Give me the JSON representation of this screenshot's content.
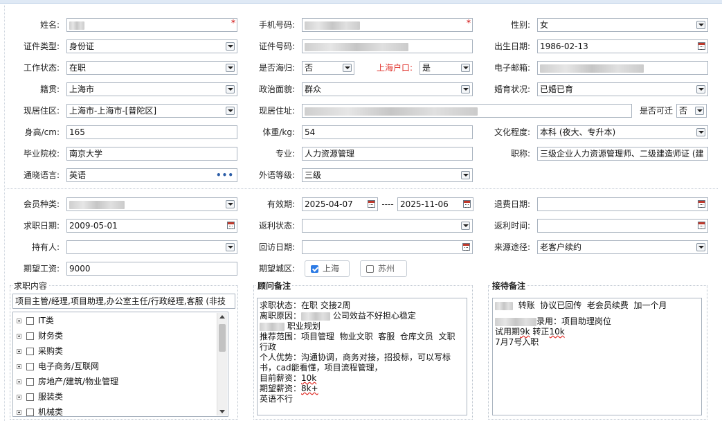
{
  "row1": {
    "name_label": "姓名:",
    "mobile_label": "手机号码:",
    "gender_label": "性别:",
    "gender_value": "女"
  },
  "row2": {
    "idtype_label": "证件类型:",
    "idtype_value": "身份证",
    "idno_label": "证件号码:",
    "birth_label": "出生日期:",
    "birth_value": "1986-02-13"
  },
  "row3": {
    "workstatus_label": "工作状态:",
    "workstatus_value": "在职",
    "returnee_label": "是否海归:",
    "returnee_value": "否",
    "hukou_label": "上海户口:",
    "hukou_value": "是",
    "email_label": "电子邮箱:"
  },
  "row4": {
    "native_label": "籍贯:",
    "native_value": "上海市",
    "political_label": "政治面貌:",
    "political_value": "群众",
    "marital_label": "婚育状况:",
    "marital_value": "已婚已育"
  },
  "row5": {
    "residence_area_label": "现居住区:",
    "residence_area_value": "上海市-上海市-[普陀区]",
    "address_label": "现居住址:",
    "relocate_label": "是否可迁",
    "relocate_value": "否"
  },
  "row6": {
    "height_label": "身高/cm:",
    "height_value": "165",
    "weight_label": "体重/kg:",
    "weight_value": "54",
    "education_label": "文化程度:",
    "education_value": "本科 (夜大、专升本)"
  },
  "row7": {
    "school_label": "毕业院校:",
    "school_value": "南京大学",
    "major_label": "专业:",
    "major_value": "人力资源管理",
    "title_label": "职称:",
    "title_value": "三级企业人力资源管理师、二级建造师证 (建"
  },
  "row8": {
    "language_label": "通晓语言:",
    "language_value": "英语",
    "language_more": "•••",
    "foreign_label": "外语等级:",
    "foreign_value": "三级"
  },
  "row9": {
    "member_label": "会员种类:",
    "valid_label": "有效期:",
    "valid_from": "2025-04-07",
    "valid_sep": "----",
    "valid_to": "2025-11-06",
    "refund_label": "退费日期:"
  },
  "row10": {
    "jobdate_label": "求职日期:",
    "jobdate_value": "2009-05-01",
    "rebate_status_label": "返利状态:",
    "rebate_time_label": "返利时间:"
  },
  "row11": {
    "holder_label": "持有人:",
    "visit_label": "回访日期:",
    "source_label": "来源途径:",
    "source_value": "老客户续约"
  },
  "row12": {
    "salary_label": "期望工资:",
    "salary_value": "9000",
    "city_label": "期望城区:",
    "city_options": [
      {
        "label": "上海",
        "checked": true
      },
      {
        "label": "苏州",
        "checked": false
      }
    ]
  },
  "job_content": {
    "title": "求职内容",
    "value": "项目主管/经理,项目助理,办公室主任/行政经理,客服 (非技",
    "tree": [
      "IT类",
      "财务类",
      "采购类",
      "电子商务/互联网",
      "房地产/建筑/物业管理",
      "服装类",
      "机械类"
    ]
  },
  "consultant": {
    "title": "顾问备注",
    "lines": [
      "求职状态：在职 交接2周",
      "离职原因：",
      "公司效益不好担心稳定",
      "职业规划",
      "推荐范围：项目管理  物业文职  客服  仓库文员  文职  行政",
      "个人优势：沟通协调，商务对接，招投标，可以写标书，cad能看懂，项目流程管理，",
      "目前薪资：",
      "10k",
      "期望薪资：",
      "8k+",
      "英语不行"
    ]
  },
  "reception": {
    "title": "接待备注",
    "line1": "转账  协议已回传  老会员续费  加一个月",
    "line2": "录用：项目助理岗位",
    "line3a": "试用期",
    "line3b": "9k",
    "line3c": " 转正",
    "line3d": "10k",
    "line4": "7月7号入职"
  }
}
